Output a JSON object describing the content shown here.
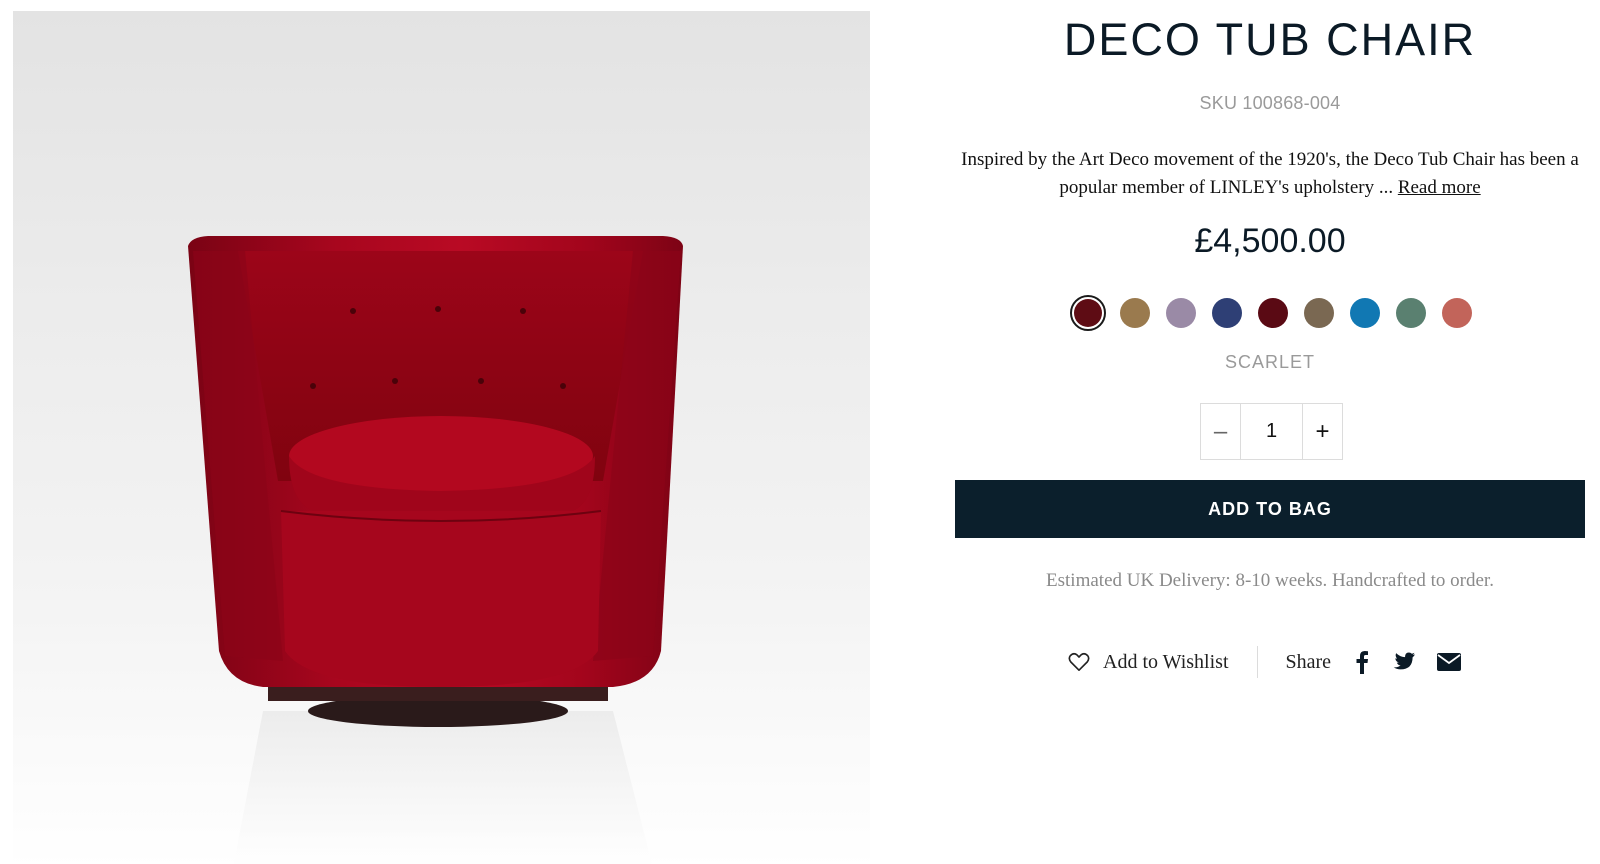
{
  "product": {
    "title": "DECO TUB CHAIR",
    "sku": "SKU 100868-004",
    "description": "Inspired by the Art Deco movement of the 1920's, the Deco Tub Chair has been a popular member of LINLEY's upholstery ...",
    "read_more": "Read more",
    "price": "£4,500.00",
    "image_alt": "red velvet tub chair"
  },
  "swatches": [
    {
      "color": "#5e0c14",
      "selected": true
    },
    {
      "color": "#9a7a4e"
    },
    {
      "color": "#9a8aa6"
    },
    {
      "color": "#2e3f75"
    },
    {
      "color": "#5a0a14"
    },
    {
      "color": "#7a6852"
    },
    {
      "color": "#1178b3"
    },
    {
      "color": "#5a8070"
    },
    {
      "color": "#c2645a"
    }
  ],
  "selected_color_name": "SCARLET",
  "quantity": {
    "minus": "–",
    "value": "1",
    "plus": "+"
  },
  "add_to_bag": "ADD TO BAG",
  "delivery": "Estimated UK Delivery: 8-10 weeks. Handcrafted to order.",
  "actions": {
    "wishlist": "Add to Wishlist",
    "share": "Share",
    "share_icons": [
      "facebook-icon",
      "twitter-icon",
      "email-icon"
    ]
  },
  "colors": {
    "primary_button": "#0b1f2c",
    "muted_text": "#9a9a9a",
    "chair_red": "#a5051c"
  }
}
